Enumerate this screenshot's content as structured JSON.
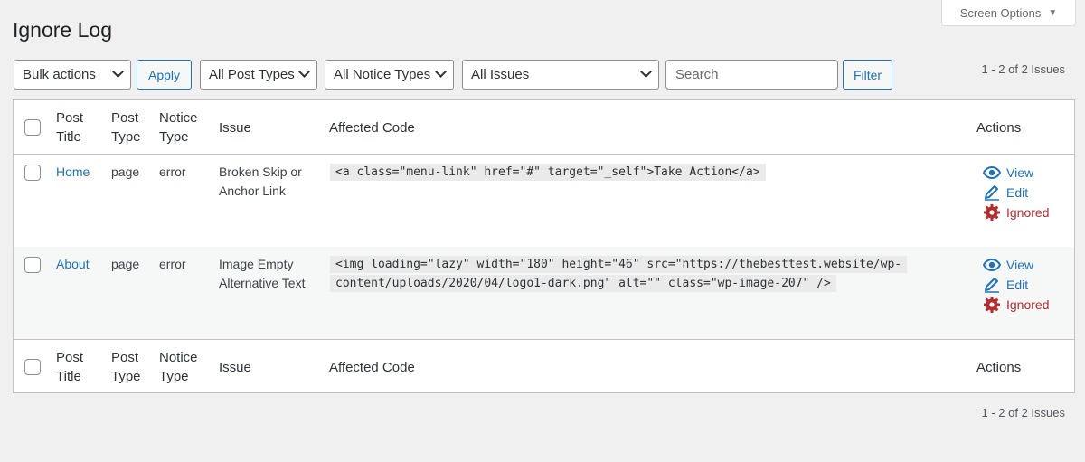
{
  "screen_options": {
    "label": "Screen Options"
  },
  "page_title": "Ignore Log",
  "toolbar": {
    "bulk_actions": "Bulk actions",
    "apply": "Apply",
    "post_types": "All Post Types",
    "notice_types": "All Notice Types",
    "issues": "All Issues",
    "search_placeholder": "Search",
    "filter": "Filter",
    "count": "1 - 2 of 2 Issues"
  },
  "columns": {
    "post_title_1": "Post",
    "post_title_2": "Title",
    "post_type_1": "Post",
    "post_type_2": "Type",
    "notice_type_1": "Notice",
    "notice_type_2": "Type",
    "issue": "Issue",
    "affected_code": "Affected Code",
    "actions": "Actions"
  },
  "rows": [
    {
      "post_title": "Home",
      "post_type": "page",
      "notice_type": "error",
      "issue_1": "Broken Skip or",
      "issue_2": "Anchor Link",
      "code_1": "<a class=\"menu-link\" href=\"#\" target=\"_self\">Take Action</a>",
      "actions": {
        "view": "View",
        "edit": "Edit",
        "ignored": "Ignored"
      }
    },
    {
      "post_title": "About",
      "post_type": "page",
      "notice_type": "error",
      "issue_1": "Image Empty",
      "issue_2": "Alternative Text",
      "code_1": "<img loading=\"lazy\" width=\"180\" height=\"46\" src=\"https://thebesttest.website/wp-",
      "code_2": "content/uploads/2020/04/logo1-dark.png\" alt=\"\" class=\"wp-image-207\" />",
      "actions": {
        "view": "View",
        "edit": "Edit",
        "ignored": "Ignored"
      }
    }
  ],
  "footer_count": "1 - 2 of 2 Issues",
  "colors": {
    "link": "#2271b1",
    "ignored": "#b32d2e",
    "border": "#c3c4c7"
  },
  "icons": [
    "eye-icon",
    "pencil-icon",
    "gear-icon",
    "chevron-down-icon",
    "triangle-down-icon"
  ]
}
